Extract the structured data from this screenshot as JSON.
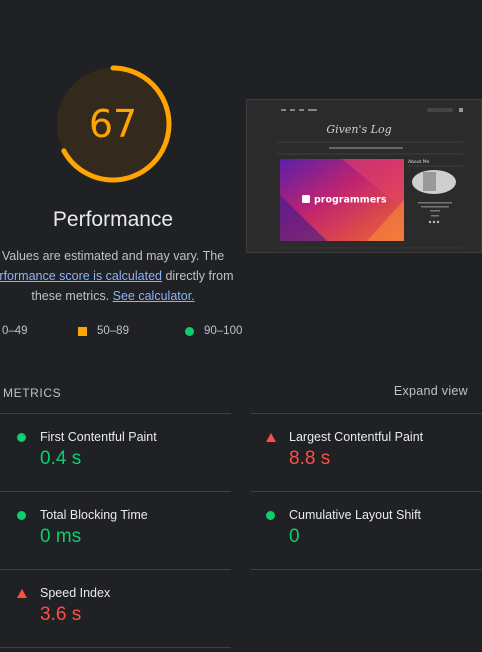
{
  "score": {
    "value": "67",
    "fraction": 0.67,
    "color": "#ffa400"
  },
  "title": "Performance",
  "description": {
    "line1": "Values are estimated and may vary. The",
    "link1": "erformance score is calculated",
    "mid": " directly from",
    "line3": "these metrics. ",
    "link2": "See calculator."
  },
  "legend": [
    {
      "label": "0–49",
      "shape": "triangle",
      "color": "#ff4e42"
    },
    {
      "label": "50–89",
      "shape": "square",
      "color": "#ffa400"
    },
    {
      "label": "90–100",
      "shape": "circle",
      "color": "#0cce6b"
    }
  ],
  "metrics": {
    "header": "METRICS",
    "expand": "Expand view",
    "items": [
      {
        "name": "First Contentful Paint",
        "value": "0.4 s",
        "status": "good"
      },
      {
        "name": "Largest Contentful Paint",
        "value": "8.8 s",
        "status": "bad"
      },
      {
        "name": "Total Blocking Time",
        "value": "0 ms",
        "status": "good"
      },
      {
        "name": "Cumulative Layout Shift",
        "value": "0",
        "status": "good"
      },
      {
        "name": "Speed Index",
        "value": "3.6 s",
        "status": "bad"
      }
    ]
  },
  "thumbnail": {
    "site_title": "Given's Log",
    "sidebar_heading": "About Me",
    "banner_text": "programmers"
  }
}
